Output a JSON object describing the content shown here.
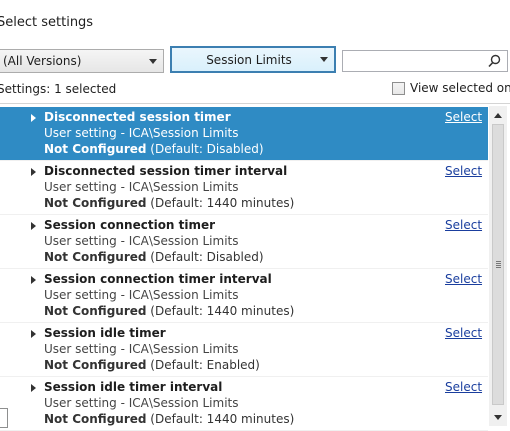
{
  "dialog": {
    "title": "Select settings"
  },
  "filters": {
    "version_value": "(All Versions)",
    "category_value": "Session Limits",
    "search_value": "",
    "settings_label": "Settings:",
    "selected_count": "1 selected",
    "view_selected_label": "View selected only",
    "view_selected_checked": false
  },
  "settings": [
    {
      "name": "Disconnected session timer",
      "scope": "User setting - ICA\\Session Limits",
      "status": "Not Configured",
      "default": "(Default: Disabled)",
      "action": "Select",
      "selected": true
    },
    {
      "name": "Disconnected session timer interval",
      "scope": "User setting - ICA\\Session Limits",
      "status": "Not Configured",
      "default": "(Default: 1440 minutes)",
      "action": "Select",
      "selected": false
    },
    {
      "name": "Session connection timer",
      "scope": "User setting - ICA\\Session Limits",
      "status": "Not Configured",
      "default": "(Default: Disabled)",
      "action": "Select",
      "selected": false
    },
    {
      "name": "Session connection timer interval",
      "scope": "User setting - ICA\\Session Limits",
      "status": "Not Configured",
      "default": "(Default: 1440 minutes)",
      "action": "Select",
      "selected": false
    },
    {
      "name": "Session idle timer",
      "scope": "User setting - ICA\\Session Limits",
      "status": "Not Configured",
      "default": "(Default: Enabled)",
      "action": "Select",
      "selected": false
    },
    {
      "name": "Session idle timer interval",
      "scope": "User setting - ICA\\Session Limits",
      "status": "Not Configured",
      "default": "(Default: 1440 minutes)",
      "action": "Select",
      "selected": false
    }
  ],
  "colors": {
    "selected_row": "#2f8bc4",
    "link": "#1a3e9e"
  },
  "icons": {
    "search": "magnifier-icon",
    "expand": "triangle-right-icon",
    "dropdown": "chevron-down-icon"
  }
}
